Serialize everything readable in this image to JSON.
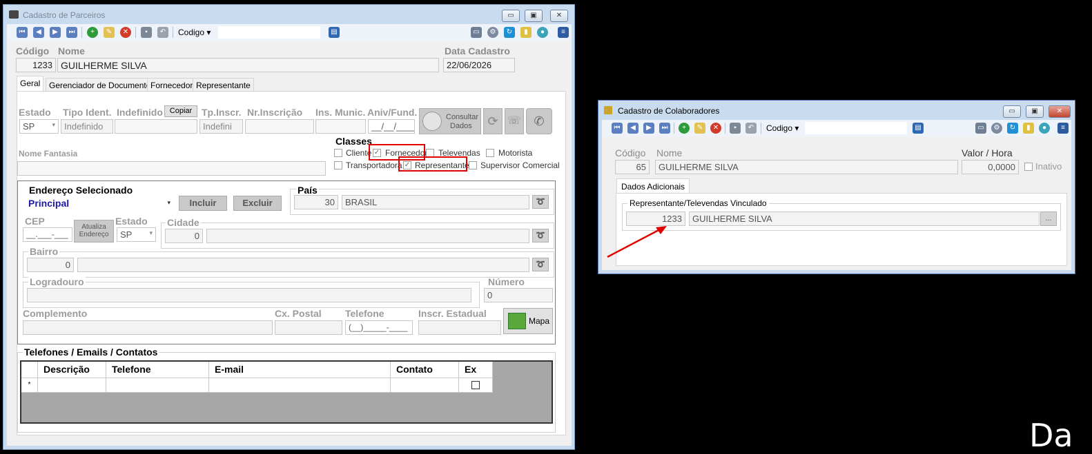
{
  "left_window": {
    "title": "Cadastro de Parceiros",
    "window_buttons": {
      "minimize": "▭",
      "maximize": "▣",
      "close": "✕"
    },
    "toolbar": {
      "combo_label": "Codigo",
      "combo_arrow": "▾"
    },
    "header": {
      "codigo_label": "Código",
      "codigo_value": "1233",
      "nome_label": "Nome",
      "nome_value": "GUILHERME SILVA",
      "data_label": "Data Cadastro",
      "data_value": "22/06/2026"
    },
    "tabs": [
      "Geral",
      "Gerenciador de Documentos",
      "Fornecedor",
      "Representante"
    ],
    "geral": {
      "estado_label": "Estado",
      "estado_value": "SP",
      "tipo_ident_label": "Tipo Ident.",
      "tipo_ident_value": "Indefinido",
      "indefinido_label": "Indefinido",
      "copiar_label": "Copiar",
      "tp_inscr_label": "Tp.Inscr.",
      "tp_inscr_value": "Indefini",
      "nr_inscricao_label": "Nr.Inscrição",
      "ins_munic_label": "Ins. Munic.",
      "aniv_label": "Aniv/Fund.",
      "aniv_value": "__/__/____",
      "consultar_label_1": "Consultar",
      "consultar_label_2": "Dados",
      "nome_fantasia_label": "Nome Fantasia",
      "classes_label": "Classes",
      "classes": [
        {
          "label": "Cliente",
          "checked": false
        },
        {
          "label": "Fornecedor",
          "checked": true
        },
        {
          "label": "Televendas",
          "checked": false
        },
        {
          "label": "Motorista",
          "checked": false
        },
        {
          "label": "Transportadora",
          "checked": false
        },
        {
          "label": "Representante",
          "checked": true
        },
        {
          "label": "Supervisor Comercial",
          "checked": false
        }
      ]
    },
    "endereco": {
      "group_label": "Endereço Selecionado",
      "selected": "Principal",
      "incluir_label": "Incluir",
      "excluir_label": "Excluir",
      "pais_label": "País",
      "pais_code": "30",
      "pais_name": "BRASIL",
      "cep_label": "CEP",
      "cep_value": "__.___-___",
      "atualiza_label_1": "Atualiza",
      "atualiza_label_2": "Endereço",
      "estado_label": "Estado",
      "estado_value": "SP",
      "cidade_label": "Cidade",
      "cidade_code": "0",
      "bairro_label": "Bairro",
      "bairro_code": "0",
      "logradouro_label": "Logradouro",
      "numero_label": "Número",
      "numero_value": "0",
      "complemento_label": "Complemento",
      "cx_postal_label": "Cx. Postal",
      "telefone_label": "Telefone",
      "telefone_value": "(__)_____-____",
      "inscr_estadual_label": "Inscr. Estadual",
      "mapa_label": "Mapa"
    },
    "contatos": {
      "group_label": "Telefones / Emails / Contatos",
      "columns": [
        "Descrição",
        "Telefone",
        "E-mail",
        "Contato",
        "Ex"
      ],
      "new_row_marker": "*"
    }
  },
  "right_window": {
    "title": "Cadastro de Colaboradores",
    "window_buttons": {
      "minimize": "▭",
      "maximize": "▣",
      "close": "✕"
    },
    "toolbar": {
      "combo_label": "Codigo",
      "combo_arrow": "▾"
    },
    "codigo_label": "Código",
    "codigo_value": "65",
    "nome_label": "Nome",
    "nome_value": "GUILHERME SILVA",
    "valor_hora_label": "Valor / Hora",
    "valor_hora_value": "0,0000",
    "inativo_label": "Inativo",
    "tab": "Dados Adicionais",
    "vinculado_label": "Representante/Televendas Vinculado",
    "vinculado_code": "1233",
    "vinculado_name": "GUILHERME SILVA",
    "lookup_label": "..."
  },
  "background_text": "Da"
}
